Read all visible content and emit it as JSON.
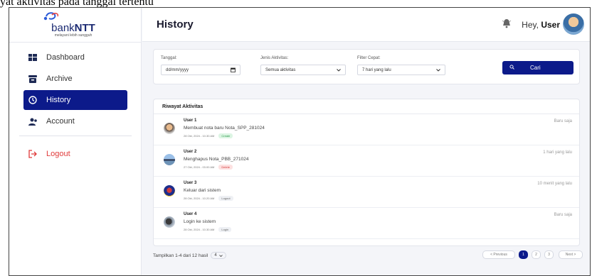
{
  "caption": "yat aktivitas pada tanggal tertentu",
  "colors": {
    "primary": "#0c1a8a",
    "logout": "#e03a3a",
    "background": "#f4f5f9"
  },
  "logo": {
    "brand_prefix": "bank",
    "brand_suffix": "NTT",
    "tagline": "melayani lebih sungguh"
  },
  "sidebar": {
    "items": [
      {
        "label": "Dashboard",
        "icon": "dashboard-icon"
      },
      {
        "label": "Archive",
        "icon": "archive-icon"
      },
      {
        "label": "History",
        "icon": "history-icon",
        "active": true
      },
      {
        "label": "Account",
        "icon": "account-icon"
      }
    ],
    "logout_label": "Logout"
  },
  "header": {
    "title": "History",
    "greeting": "Hey,",
    "user": "User"
  },
  "filters": {
    "date_label": "Tanggal:",
    "date_value": "dd/mm/yyyy",
    "type_label": "Jenis Aktivitas:",
    "type_value": "Semua aktivitas",
    "quick_label": "Filter Cepat:",
    "quick_value": "7 hari yang lalu",
    "search_button": "Cari"
  },
  "activity": {
    "title": "Riwayat Aktivitas",
    "rows": [
      {
        "user": "User 1",
        "desc": "Membuat nota baru Nota_SPP_281024",
        "meta": "28 Okt, 2024 - 10.30 AM",
        "badge": "Create",
        "time": "Baru saja"
      },
      {
        "user": "User 2",
        "desc": "Menghapus Nota_PBB_271024",
        "meta": "27 Okt, 2024 - 03.00 AM",
        "badge": "Delete",
        "time": "1 hari yang lalu"
      },
      {
        "user": "User 3",
        "desc": "Keluar dari sistem",
        "meta": "28 Okt, 2024 - 10.20 AM",
        "badge": "Logout",
        "time": "10 menit yang lalu"
      },
      {
        "user": "User 4",
        "desc": "Login ke sistem",
        "meta": "28 Okt, 2024 - 10.30 AM",
        "badge": "Login",
        "time": "Baru saja"
      }
    ]
  },
  "pagination": {
    "info": "Tampilkan 1-4 dari 12 hasil",
    "per_page": "4",
    "previous": "< Previous",
    "pages": [
      "1",
      "2",
      "3"
    ],
    "current_page": "1",
    "next": "Next >"
  }
}
